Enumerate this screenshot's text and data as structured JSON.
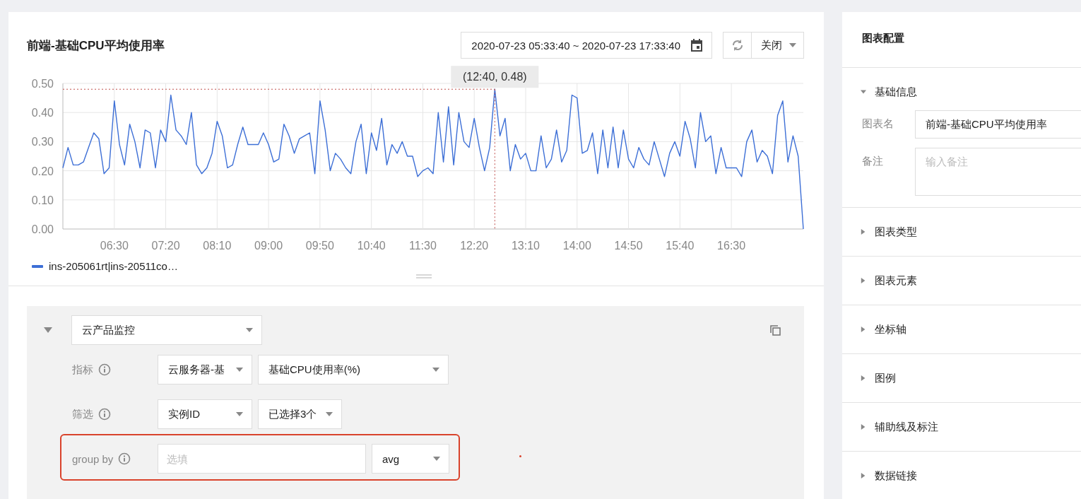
{
  "chart_panel": {
    "title": "前端-基础CPU平均使用率",
    "time_range": "2020-07-23 05:33:40 ~ 2020-07-23 17:33:40",
    "refresh_menu": "关闭",
    "chart_data": {
      "type": "line",
      "x": [
        340,
        345,
        350,
        355,
        360,
        365,
        370,
        375,
        380,
        385,
        390,
        395,
        400,
        405,
        410,
        415,
        420,
        425,
        430,
        435,
        440,
        445,
        450,
        455,
        460,
        465,
        470,
        475,
        480,
        485,
        490,
        495,
        500,
        505,
        510,
        515,
        520,
        525,
        530,
        535,
        540,
        545,
        550,
        555,
        560,
        565,
        570,
        575,
        580,
        585,
        590,
        595,
        600,
        605,
        610,
        615,
        620,
        625,
        630,
        635,
        640,
        645,
        650,
        655,
        660,
        665,
        670,
        675,
        680,
        685,
        690,
        695,
        700,
        705,
        710,
        715,
        720,
        725,
        730,
        735,
        740,
        745,
        750,
        755,
        760,
        765,
        770,
        775,
        780,
        785,
        790,
        795,
        800,
        805,
        810,
        815,
        820,
        825,
        830,
        835,
        840,
        845,
        850,
        855,
        860,
        865,
        870,
        875,
        880,
        885,
        890,
        895,
        900,
        905,
        910,
        915,
        920,
        925,
        930,
        935,
        940,
        945,
        950,
        955,
        960,
        965,
        970,
        975,
        980,
        985,
        990,
        995,
        1000,
        1005,
        1010,
        1015,
        1020,
        1025,
        1030,
        1035,
        1040,
        1045,
        1050,
        1055,
        1060
      ],
      "xlim": [
        340,
        1060
      ],
      "grid": true,
      "series": [
        {
          "name": "ins-205061rt|ins-20511co…",
          "color": "#3d6fd6",
          "values": [
            0.21,
            0.28,
            0.22,
            0.22,
            0.23,
            0.28,
            0.33,
            0.31,
            0.19,
            0.21,
            0.44,
            0.29,
            0.22,
            0.36,
            0.3,
            0.21,
            0.34,
            0.33,
            0.21,
            0.34,
            0.3,
            0.46,
            0.34,
            0.32,
            0.29,
            0.4,
            0.22,
            0.19,
            0.21,
            0.26,
            0.37,
            0.32,
            0.21,
            0.22,
            0.29,
            0.35,
            0.29,
            0.29,
            0.29,
            0.33,
            0.29,
            0.23,
            0.24,
            0.36,
            0.32,
            0.26,
            0.31,
            0.32,
            0.33,
            0.19,
            0.44,
            0.34,
            0.2,
            0.26,
            0.24,
            0.21,
            0.19,
            0.3,
            0.36,
            0.19,
            0.33,
            0.27,
            0.38,
            0.22,
            0.29,
            0.26,
            0.3,
            0.25,
            0.25,
            0.18,
            0.2,
            0.21,
            0.19,
            0.4,
            0.23,
            0.42,
            0.22,
            0.4,
            0.3,
            0.28,
            0.38,
            0.28,
            0.2,
            0.28,
            0.48,
            0.32,
            0.38,
            0.2,
            0.29,
            0.24,
            0.26,
            0.2,
            0.2,
            0.32,
            0.21,
            0.24,
            0.34,
            0.23,
            0.27,
            0.46,
            0.45,
            0.26,
            0.27,
            0.33,
            0.19,
            0.34,
            0.21,
            0.35,
            0.21,
            0.34,
            0.24,
            0.21,
            0.28,
            0.24,
            0.22,
            0.3,
            0.24,
            0.18,
            0.26,
            0.3,
            0.25,
            0.37,
            0.31,
            0.21,
            0.4,
            0.3,
            0.32,
            0.19,
            0.28,
            0.21,
            0.21,
            0.21,
            0.18,
            0.3,
            0.34,
            0.23,
            0.27,
            0.25,
            0.19,
            0.39,
            0.44,
            0.23,
            0.32,
            0.25,
            0.0
          ]
        }
      ],
      "ylim": [
        0,
        0.5
      ],
      "yticks": [
        {
          "value": 0,
          "label": "0.00"
        },
        {
          "value": 0.1,
          "label": "0.10"
        },
        {
          "value": 0.2,
          "label": "0.20"
        },
        {
          "value": 0.3,
          "label": "0.30"
        },
        {
          "value": 0.4,
          "label": "0.40"
        },
        {
          "value": 0.5,
          "label": "0.50"
        }
      ],
      "xticks": [
        {
          "value": 390,
          "label": "06:30"
        },
        {
          "value": 440,
          "label": "07:20"
        },
        {
          "value": 490,
          "label": "08:10"
        },
        {
          "value": 540,
          "label": "09:00"
        },
        {
          "value": 590,
          "label": "09:50"
        },
        {
          "value": 640,
          "label": "10:40"
        },
        {
          "value": 690,
          "label": "11:30"
        },
        {
          "value": 740,
          "label": "12:20"
        },
        {
          "value": 790,
          "label": "13:10"
        },
        {
          "value": 840,
          "label": "14:00"
        },
        {
          "value": 890,
          "label": "14:50"
        },
        {
          "value": 940,
          "label": "15:40"
        },
        {
          "value": 990,
          "label": "16:30"
        }
      ],
      "ref_lines": [
        {
          "axis": "y",
          "value": 0.48,
          "color": "#c0504d"
        },
        {
          "axis": "x",
          "value": 760,
          "color": "#c0504d"
        }
      ],
      "annotations": [
        {
          "x": 760,
          "y": 0.48,
          "text": "(12:40, 0.48)"
        }
      ]
    }
  },
  "query": {
    "expanded": true,
    "source": "云产品监控",
    "rows": [
      {
        "label": "指标",
        "kind": "selects",
        "selects": [
          "云服务器-基",
          "基础CPU使用率(%)"
        ]
      },
      {
        "label": "筛选",
        "kind": "selects",
        "selects": [
          "实例ID",
          "已选择3个"
        ]
      },
      {
        "label": "group by",
        "kind": "input_select",
        "placeholder": "选填",
        "selects": [
          "avg"
        ],
        "highlighted": true
      }
    ]
  },
  "config": {
    "title": "图表配置",
    "sections": [
      {
        "label": "基础信息",
        "expanded": true,
        "fields": [
          {
            "label": "图表名",
            "kind": "input",
            "value": "前端-基础CPU平均使用率"
          },
          {
            "label": "备注",
            "kind": "textarea",
            "placeholder": "输入备注"
          }
        ]
      },
      {
        "label": "图表类型",
        "expanded": false
      },
      {
        "label": "图表元素",
        "expanded": false
      },
      {
        "label": "坐标轴",
        "expanded": false
      },
      {
        "label": "图例",
        "expanded": false
      },
      {
        "label": "辅助线及标注",
        "expanded": false
      },
      {
        "label": "数据链接",
        "expanded": false
      }
    ]
  }
}
